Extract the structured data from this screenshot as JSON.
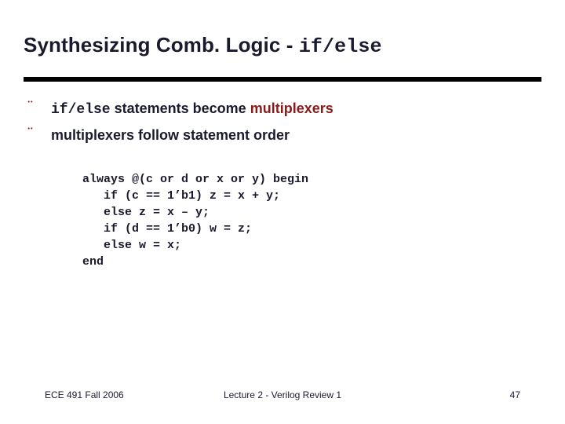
{
  "slide": {
    "title_prefix": "Synthesizing Comb. Logic - ",
    "title_mono": "if/else",
    "bullets": [
      {
        "marker": "¨",
        "mono_lead": "if/else",
        "text_mid": " statements become ",
        "accent_tail": "multiplexers"
      },
      {
        "marker": "¨",
        "mono_lead": "",
        "text_mid": "multiplexers follow statement order",
        "accent_tail": ""
      }
    ],
    "code": "always @(c or d or x or y) begin\n   if (c == 1’b1) z = x + y;\n   else z = x – y;\n   if (d == 1’b0) w = z;\n   else w = x;\nend",
    "footer": {
      "left": "ECE 491 Fall 2006",
      "center": "Lecture 2 - Verilog Review 1",
      "right": "47"
    },
    "colors": {
      "text": "#1a1a2e",
      "accent": "#8b1a1a",
      "rule": "#000000",
      "background": "#ffffff"
    }
  }
}
